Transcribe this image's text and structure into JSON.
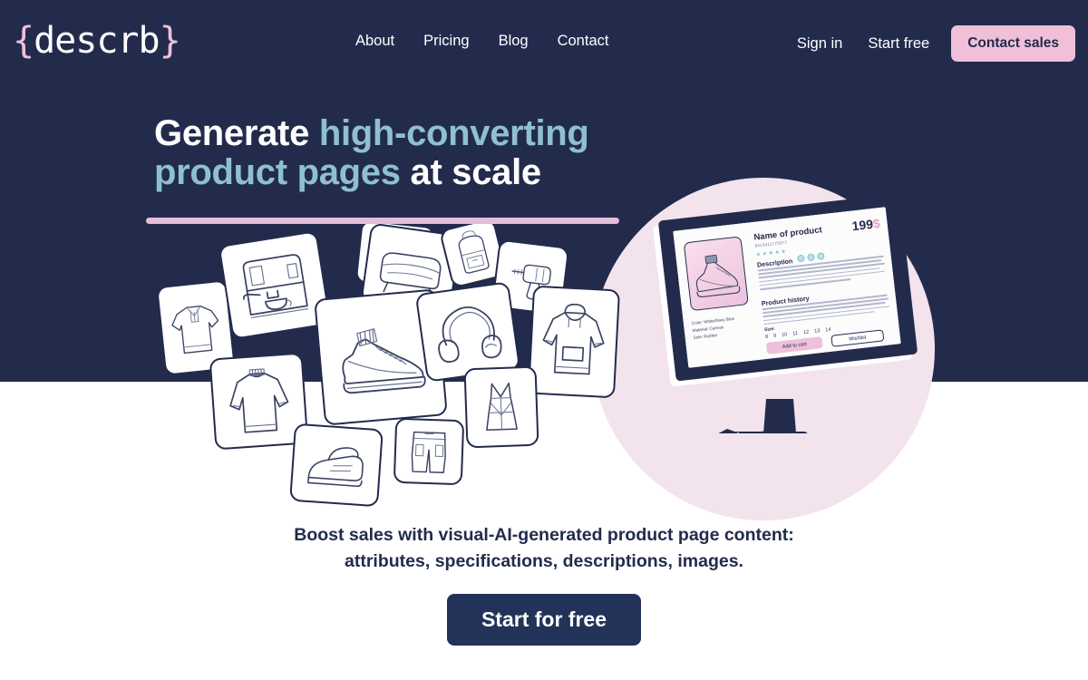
{
  "brand": {
    "open_brace": "{",
    "name": "descrb",
    "close_brace": "}"
  },
  "nav": {
    "main": [
      {
        "label": "About"
      },
      {
        "label": "Pricing"
      },
      {
        "label": "Blog"
      },
      {
        "label": "Contact"
      }
    ],
    "right": [
      {
        "label": "Sign in"
      },
      {
        "label": "Start free"
      }
    ],
    "cta_label": "Contact sales"
  },
  "hero": {
    "headline_part1": "Generate ",
    "headline_accent1": "high-converting",
    "headline_accent2": "product pages",
    "headline_part2": " at scale",
    "subcopy_line1": "Boost sales with visual-AI-generated product page content:",
    "subcopy_line2": "attributes, specifications, descriptions, images.",
    "cta_label": "Start for free"
  },
  "mockup": {
    "product_title": "Name of product",
    "price": "199",
    "currency": "$",
    "sku": "6413412775077",
    "stars": "★★★★★",
    "description_heading": "Description",
    "history_heading": "Product history",
    "attributes": [
      "Color: White/Navy Blue",
      "Material: Canvas",
      "Sole: Rubber"
    ],
    "size_label": "Size:",
    "sizes": [
      "8",
      "9",
      "10",
      "11",
      "12",
      "13",
      "14"
    ],
    "add_to_cart_label": "Add to cart",
    "wishlist_label": "Wishlist"
  },
  "cards": [
    {
      "item": "polo-shirt"
    },
    {
      "item": "coffee-machine"
    },
    {
      "item": "hair-dryer"
    },
    {
      "item": "sofa"
    },
    {
      "item": "backpack"
    },
    {
      "item": "drill"
    },
    {
      "item": "sweater"
    },
    {
      "item": "sneaker"
    },
    {
      "item": "headphones"
    },
    {
      "item": "hoodie"
    },
    {
      "item": "dress"
    },
    {
      "item": "iron"
    },
    {
      "item": "shorts"
    }
  ],
  "colors": {
    "navy": "#232b4d",
    "pink": "#f0c0d8",
    "pink_pale": "#f3e3ec",
    "accent_blue": "#8fc0d0",
    "white": "#ffffff"
  }
}
